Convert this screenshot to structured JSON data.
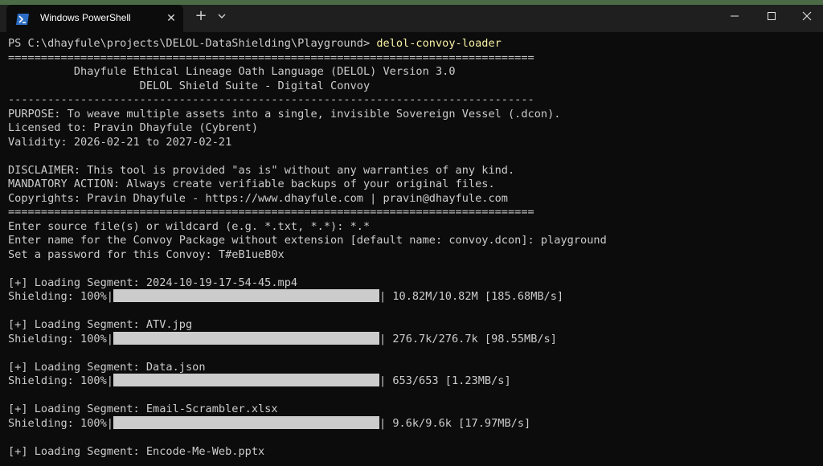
{
  "window": {
    "tab_title": "Windows PowerShell",
    "tab_icon": "powershell-icon",
    "close_tab_glyph": "✕",
    "new_tab_glyph": "+",
    "controls": [
      "minimize-icon",
      "maximize-icon",
      "close-icon"
    ]
  },
  "prompt": {
    "path": "PS C:\\dhayfule\\projects\\DELOL-DataShielding\\Playground> ",
    "command": "delol-convoy-loader"
  },
  "banner": {
    "sep_double": "================================================================================",
    "title": "          Dhayfule Ethical Lineage Oath Language (DELOL) Version 3.0",
    "subtitle": "                    DELOL Shield Suite - Digital Convoy",
    "sep_single": "--------------------------------------------------------------------------------",
    "purpose": "PURPOSE: To weave multiple assets into a single, invisible Sovereign Vessel (.dcon).",
    "licensed": "Licensed to: Pravin Dhayfule (Cybrent)",
    "validity": "Validity: 2026-02-21 to 2027-02-21",
    "disclaimer": "DISCLAIMER: This tool is provided \"as is\" without any warranties of any kind.",
    "mandatory": "MANDATORY ACTION: Always create verifiable backups of your original files.",
    "copyrights": "Copyrights: Pravin Dhayfule - https://www.dhayfule.com | pravin@dhayfule.com"
  },
  "inputs": {
    "source": "Enter source file(s) or wildcard (e.g. *.txt, *.*): *.*",
    "package_name": "Enter name for the Convoy Package without extension [default name: convoy.dcon]: playground",
    "password": "Set a password for this Convoy: T#eB1ueB0x"
  },
  "segments": [
    {
      "loading": "[+] Loading Segment: 2024-10-19-17-54-45.mp4",
      "status": "Shielding: 100%|",
      "progress": 1.0,
      "stats": "| 10.82M/10.82M [185.68MB/s]"
    },
    {
      "loading": "[+] Loading Segment: ATV.jpg",
      "status": "Shielding: 100%|",
      "progress": 1.0,
      "stats": "| 276.7k/276.7k [98.55MB/s]"
    },
    {
      "loading": "[+] Loading Segment: Data.json",
      "status": "Shielding: 100%|",
      "progress": 1.0,
      "stats": "| 653/653 [1.23MB/s]"
    },
    {
      "loading": "[+] Loading Segment: Email-Scrambler.xlsx",
      "status": "Shielding: 100%|",
      "progress": 1.0,
      "stats": "| 9.6k/9.6k [17.97MB/s]"
    },
    {
      "loading": "[+] Loading Segment: Encode-Me-Web.pptx"
    }
  ],
  "colors": {
    "background": "#0c0c0c",
    "text": "#cccccc",
    "command": "#f9f1a5",
    "titlebar": "#1f1f1f",
    "accent_strip": "#4a6b45"
  }
}
